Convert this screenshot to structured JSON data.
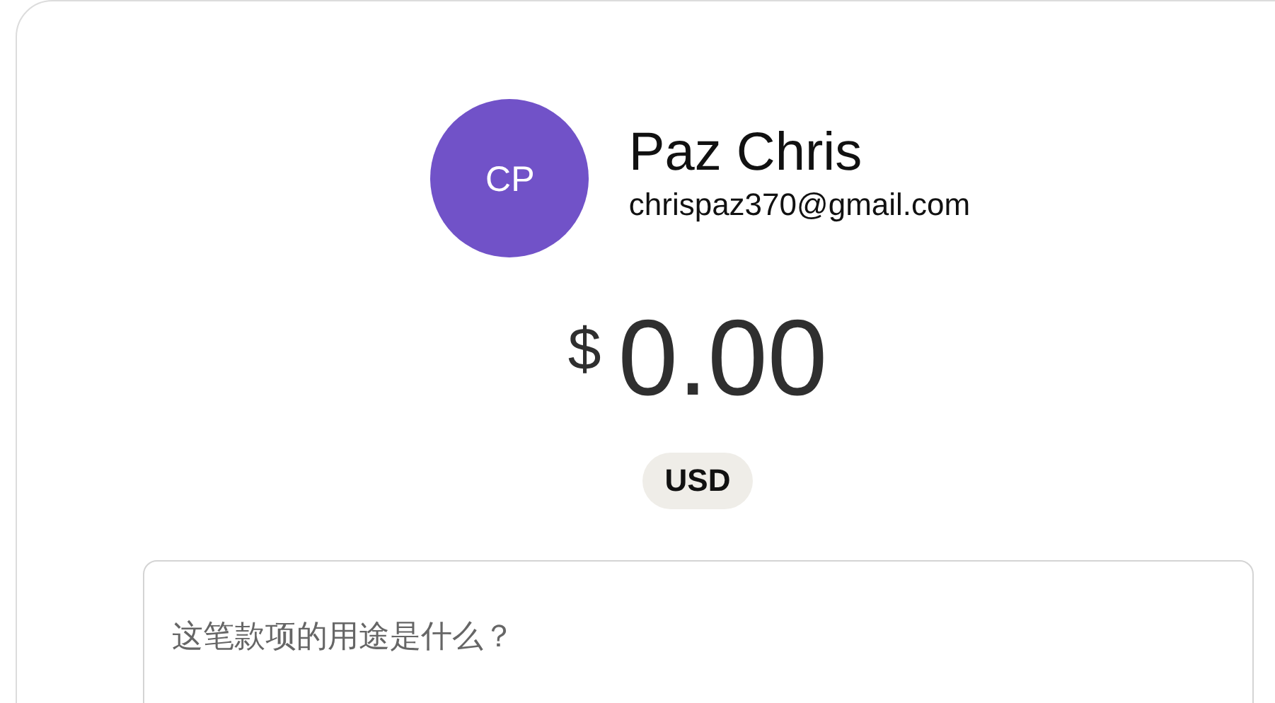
{
  "profile": {
    "initials": "CP",
    "name": "Paz Chris",
    "email": "chrispaz370@gmail.com"
  },
  "amount": {
    "symbol": "$",
    "value": "0.00"
  },
  "currency": "USD",
  "note": {
    "placeholder": "这笔款项的用途是什么？"
  }
}
